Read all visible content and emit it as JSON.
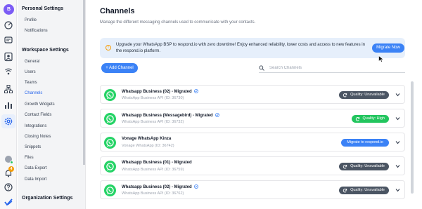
{
  "rail": {
    "avatar_letter": "B",
    "notification_count": "4"
  },
  "sidebar": {
    "personal_title": "Personal Settings",
    "personal_items": [
      "Profile",
      "Notifications"
    ],
    "workspace_title": "Workspace Settings",
    "workspace_items": [
      "General",
      "Users",
      "Teams",
      "Channels",
      "Growth Widgets",
      "Contact Fields",
      "Integrations",
      "Closing Notes",
      "Snippets",
      "Files",
      "Data Export",
      "Data Import"
    ],
    "active_item": "Channels",
    "org_title": "Organization Settings"
  },
  "header": {
    "title": "Channels",
    "subtitle": "Manage the different messaging channels used to communicate with your contacts."
  },
  "banner": {
    "text": "Upgrade your WhatsApp BSP to respond.io with zero downtime! Enjoy enhanced reliability, lower costs and access to new features in the respond.io platform.",
    "button_label": "Migrate Now"
  },
  "toolbar": {
    "add_label": "+ Add Channel",
    "search_placeholder": "Search Channels"
  },
  "channels": [
    {
      "name": "Whatsapp Business (02) - Migrated",
      "verified": true,
      "sub": "WhatsApp Business API (ID: 36730)",
      "status": "Quality: Unavailable",
      "status_type": "gray"
    },
    {
      "name": "Whatsapp Business (Messagebird) - Migrated",
      "verified": true,
      "sub": "WhatsApp Business API (ID: 36732)",
      "status": "Quality: High",
      "status_type": "green"
    },
    {
      "name": "Vonage WhatsApp Kinza",
      "verified": false,
      "sub": "Vonage WhatsApp (ID: 36742)",
      "status": "Migrate to respond.io",
      "status_type": "blue"
    },
    {
      "name": "Whatsapp Business (01) - Migrated",
      "verified": false,
      "sub": "WhatsApp Business API (ID: 36759)",
      "status": "Quality: Unavailable",
      "status_type": "gray"
    },
    {
      "name": "Whatsapp Business (02) - Migrated",
      "verified": true,
      "sub": "WhatsApp Business API (ID: 36762)",
      "status": "Quality: Unavailable",
      "status_type": "gray"
    }
  ],
  "colors": {
    "accent": "#3b82f6",
    "whatsapp": "#25d366",
    "banner_bg": "#e6effb",
    "quality_gray": "#4b5563",
    "quality_green": "#22c55e"
  }
}
